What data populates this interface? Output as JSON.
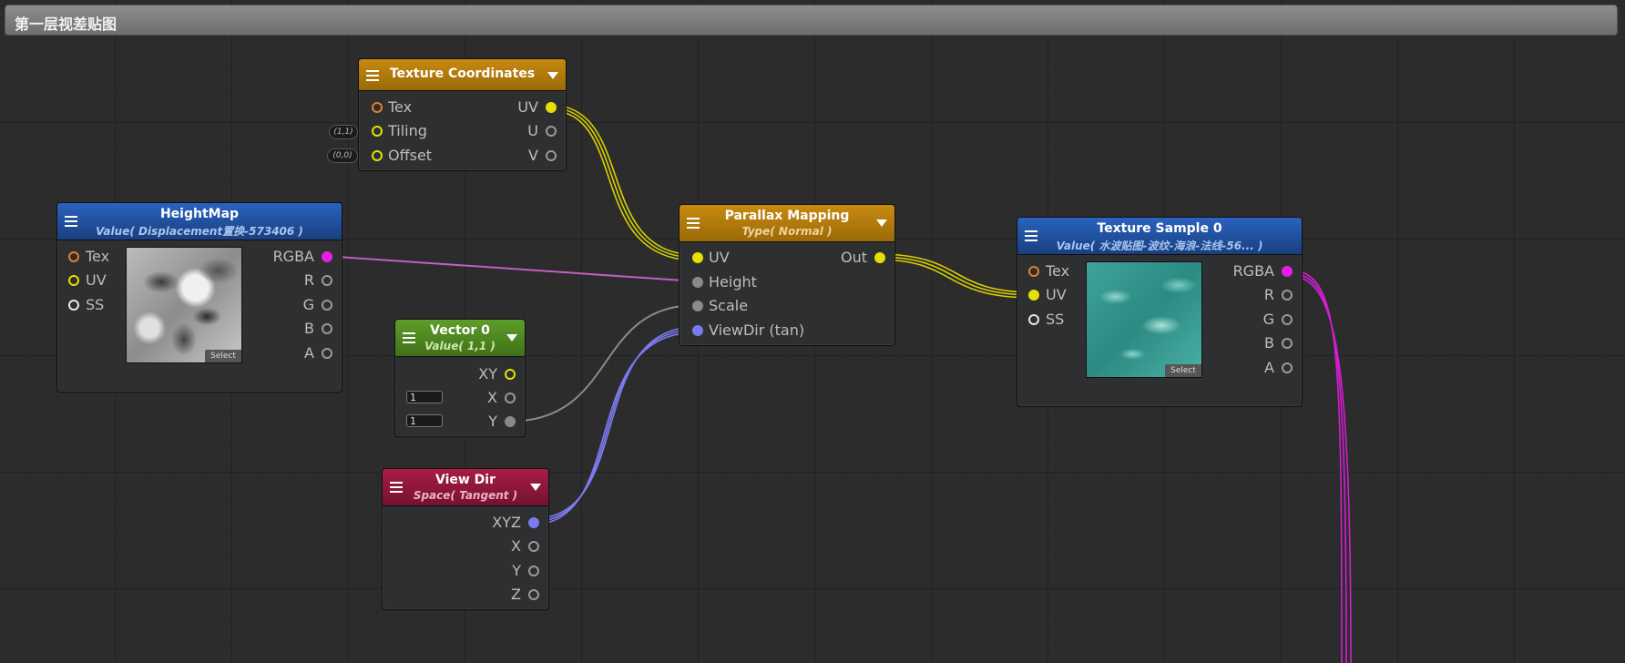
{
  "graph": {
    "title": "第一层视差贴图"
  },
  "colors": {
    "uv": "#e6e000",
    "rgba": "#e61ee6",
    "float": "#9a9a9a",
    "vector3": "#7b7bf0",
    "texture_coordinates_header": "#b27a0e",
    "parallax_header": "#b27a0e",
    "heightmap_header": "#1e4f9e",
    "texture_sample_header": "#1e4f9e",
    "vector_header": "#4d8a22",
    "viewdir_header": "#8c1636"
  },
  "nodes": {
    "texture_coordinates": {
      "title": "Texture Coordinates",
      "inputs": [
        "Tex",
        "Tiling",
        "Offset"
      ],
      "outputs": [
        "UV",
        "U",
        "V"
      ],
      "tiling_default": "(1,1)",
      "offset_default": "(0,0)"
    },
    "heightmap": {
      "title": "HeightMap",
      "subtitle": "Value( Displacement置换-573406 )",
      "inputs": [
        "Tex",
        "UV",
        "SS"
      ],
      "outputs": [
        "RGBA",
        "R",
        "G",
        "B",
        "A"
      ],
      "select_label": "Select"
    },
    "parallax_mapping": {
      "title": "Parallax Mapping",
      "subtitle": "Type( Normal )",
      "inputs": [
        "UV",
        "Height",
        "Scale",
        "ViewDir (tan)"
      ],
      "outputs": [
        "Out"
      ]
    },
    "vector0": {
      "title": "Vector 0",
      "subtitle": "Value( 1,1 )",
      "outputs": [
        "XY",
        "X",
        "Y"
      ],
      "x_value": "1",
      "y_value": "1"
    },
    "view_dir": {
      "title": "View Dir",
      "subtitle": "Space( Tangent )",
      "outputs": [
        "XYZ",
        "X",
        "Y",
        "Z"
      ]
    },
    "texture_sample": {
      "title": "Texture Sample 0",
      "subtitle": "Value( 水波贴图-波纹-海浪-法线-56... )",
      "inputs": [
        "Tex",
        "UV",
        "SS"
      ],
      "outputs": [
        "RGBA",
        "R",
        "G",
        "B",
        "A"
      ],
      "select_label": "Select"
    }
  }
}
